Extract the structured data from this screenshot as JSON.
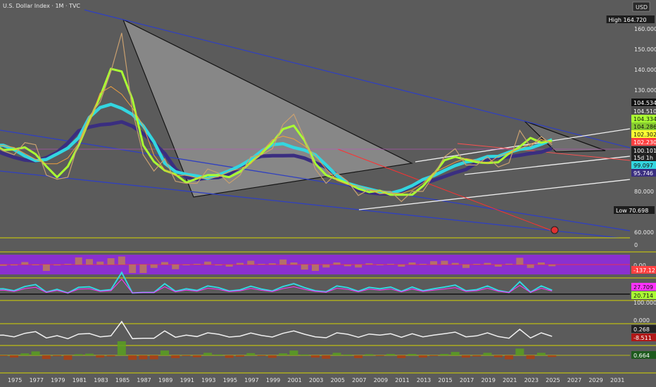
{
  "title": "U.S. Dollar Index · 1M · TVC",
  "currency": "USD",
  "colors": {
    "background": "#5b5b5b",
    "accent_yellow": "#d6d600",
    "blue_line": "#3040c0",
    "teal": "#33d6e0",
    "navy": "#3a2e80",
    "green": "#aaff33",
    "red": "#ff3030",
    "purple_panel": "#8a30d0",
    "orange_hist": "#c68a40"
  },
  "chart_data": {
    "type": "line",
    "series": [
      {
        "x": [
          1972,
          1973,
          1974,
          1975,
          1976,
          1977,
          1978,
          1979,
          1980,
          1981,
          1982,
          1983,
          1984,
          1985,
          1986,
          1987,
          1988,
          1989,
          1990,
          1991,
          1992,
          1993,
          1994,
          1995,
          1996,
          1997,
          1998,
          1999,
          2000,
          2001,
          2002,
          2003,
          2004,
          2005,
          2006,
          2007,
          2008,
          2009,
          2010,
          2011,
          2012,
          2013,
          2014,
          2015,
          2016,
          2017,
          2018,
          2019,
          2020,
          2021,
          2022,
          2023,
          2024,
          2025
        ],
        "values": [
          108,
          103,
          100,
          98,
          104,
          103,
          88,
          86,
          87,
          104,
          117,
          124,
          139,
          158,
          120,
          98,
          90,
          96,
          85,
          84,
          84,
          91,
          89,
          84,
          88,
          97,
          98,
          101,
          113,
          118,
          106,
          91,
          84,
          89,
          85,
          78,
          81,
          80,
          80,
          75,
          80,
          80,
          88,
          97,
          101,
          93,
          93,
          97,
          92,
          94,
          110,
          102,
          107,
          103
        ]
      }
    ],
    "price_labels": [
      {
        "text": "High",
        "value": "164.720"
      },
      {
        "value": "104.534"
      },
      {
        "value": "104.510"
      },
      {
        "value": "104.334"
      },
      {
        "value": "104.286"
      },
      {
        "value": "102.302"
      },
      {
        "value": "102.230"
      },
      {
        "value": "100.101"
      },
      {
        "value": "15d 1h"
      },
      {
        "value": "99.097"
      },
      {
        "value": "95.746"
      },
      {
        "text": "Low",
        "value": "70.698"
      }
    ],
    "y_ticks": [
      "160.000",
      "150.000",
      "140.000",
      "130.000",
      "80.000",
      "60.000",
      "0"
    ],
    "x_ticks": [
      "1975",
      "1977",
      "1979",
      "1981",
      "1983",
      "1985",
      "1987",
      "1989",
      "1991",
      "1993",
      "1995",
      "1997",
      "1999",
      "2001",
      "2003",
      "2005",
      "2007",
      "2009",
      "2011",
      "2013",
      "2015",
      "2017",
      "2019",
      "2021",
      "2023",
      "2025",
      "2027",
      "2029",
      "2031"
    ],
    "panel_labels": {
      "p1": {
        "tick": "0.00",
        "value": "-137.12"
      },
      "p2": {
        "v1": "27.709",
        "v2": "20.714",
        "tick": "100.000"
      },
      "p3": {
        "tick": "0.000",
        "v1": "0.268",
        "v2": "-8.511"
      },
      "p4": {
        "v1": "0.664"
      }
    }
  }
}
